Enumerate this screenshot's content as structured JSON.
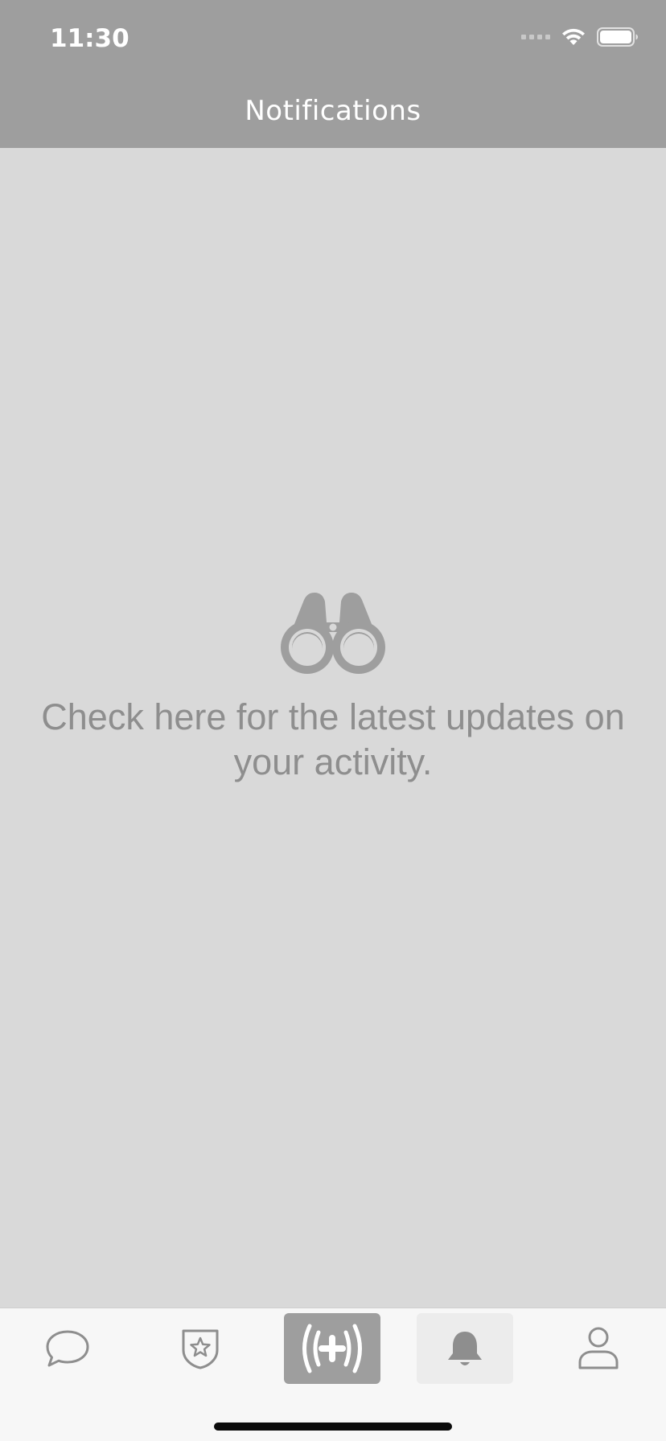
{
  "status_bar": {
    "time": "11:30"
  },
  "header": {
    "title": "Notifications"
  },
  "empty_state": {
    "icon": "binoculars-icon",
    "message": "Check here for the latest updates on your activity."
  },
  "tab_bar": {
    "selected": "notifications",
    "tabs": [
      {
        "id": "messages",
        "icon": "chat-bubble-icon"
      },
      {
        "id": "favorites",
        "icon": "star-shield-icon"
      },
      {
        "id": "live",
        "icon": "broadcast-plus-icon"
      },
      {
        "id": "notifications",
        "icon": "bell-icon"
      },
      {
        "id": "profile",
        "icon": "person-icon"
      }
    ]
  },
  "colors": {
    "header_background": "#9e9e9e",
    "content_background": "#d9d9d9",
    "muted_text": "#8e8e8e",
    "tab_bar_background": "#f7f7f7",
    "selected_tab_background": "#ececec"
  }
}
